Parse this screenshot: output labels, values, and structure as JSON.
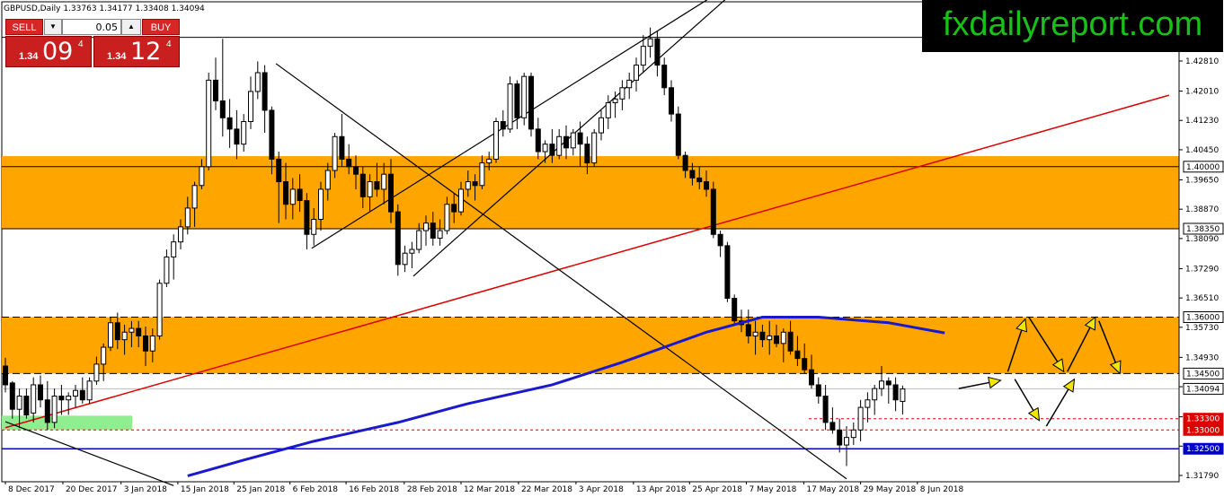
{
  "window": {
    "symbol_info": "GBPUSD,Daily",
    "ohlc": "1.33763 1.34177 1.33408 1.34094"
  },
  "brand": {
    "text": "fxdailyreport.com",
    "color": "#18c018"
  },
  "trade_panel": {
    "sell_label": "SELL",
    "buy_label": "BUY",
    "lot_size": "0.05",
    "sell_quote": {
      "prefix": "1.34",
      "big": "09",
      "sup": "4"
    },
    "buy_quote": {
      "prefix": "1.34",
      "big": "12",
      "sup": "4"
    }
  },
  "colors": {
    "zone": "#ffa500",
    "trendline_red": "#dd0000",
    "moving_average": "#1a1acc",
    "support_blue": "#0000cc",
    "green_zone": "#90ee90",
    "arrow_fill": "#f2e600"
  },
  "chart_data": {
    "type": "candlestick",
    "price_ticks": [
      "1.42810",
      "1.42010",
      "1.41230",
      "1.40450",
      "1.39650",
      "1.38870",
      "1.38090",
      "1.37290",
      "1.36510",
      "1.35730",
      "1.34930",
      "1.34150",
      "1.33350",
      "1.32570",
      "1.31790"
    ],
    "date_labels": [
      "8 Dec 2017",
      "20 Dec 2017",
      "3 Jan 2018",
      "15 Jan 2018",
      "25 Jan 2018",
      "6 Feb 2018",
      "16 Feb 2018",
      "28 Feb 2018",
      "12 Mar 2018",
      "22 Mar 2018",
      "3 Apr 2018",
      "13 Apr 2018",
      "25 Apr 2018",
      "7 May 2018",
      "17 May 2018",
      "29 May 2018",
      "8 Jun 2018"
    ],
    "level_labels": [
      {
        "label": "1.40000",
        "value": 1.4,
        "style": "black-solid"
      },
      {
        "label": "1.38350",
        "value": 1.3835,
        "style": "black-solid"
      },
      {
        "label": "1.36000",
        "value": 1.36,
        "style": "black-dashed"
      },
      {
        "label": "1.34500",
        "value": 1.345,
        "style": "black-dashed"
      },
      {
        "label": "1.34094",
        "value": 1.34094,
        "style": "current-price"
      },
      {
        "label": "1.33300",
        "value": 1.333,
        "style": "red-dashed"
      },
      {
        "label": "1.33000",
        "value": 1.33,
        "style": "red-dashed"
      },
      {
        "label": "1.32500",
        "value": 1.325,
        "style": "blue-solid"
      }
    ],
    "zones": [
      {
        "from": 1.3835,
        "to": 1.4028,
        "color": "orange"
      },
      {
        "from": 1.345,
        "to": 1.36,
        "color": "orange"
      }
    ],
    "candles": [
      [
        1.347,
        1.3492,
        1.34,
        1.342
      ],
      [
        1.3425,
        1.343,
        1.333,
        1.3355
      ],
      [
        1.3355,
        1.341,
        1.3305,
        1.339
      ],
      [
        1.339,
        1.341,
        1.333,
        1.334
      ],
      [
        1.3345,
        1.344,
        1.332,
        1.342
      ],
      [
        1.342,
        1.3445,
        1.336,
        1.338
      ],
      [
        1.338,
        1.343,
        1.33,
        1.332
      ],
      [
        1.332,
        1.341,
        1.3305,
        1.339
      ],
      [
        1.339,
        1.342,
        1.334,
        1.338
      ],
      [
        1.338,
        1.34,
        1.334,
        1.339
      ],
      [
        1.339,
        1.342,
        1.336,
        1.3405
      ],
      [
        1.3405,
        1.344,
        1.337,
        1.338
      ],
      [
        1.338,
        1.344,
        1.337,
        1.343
      ],
      [
        1.343,
        1.3495,
        1.342,
        1.3475
      ],
      [
        1.3475,
        1.353,
        1.343,
        1.352
      ],
      [
        1.352,
        1.36,
        1.351,
        1.3585
      ],
      [
        1.3585,
        1.3612,
        1.3515,
        1.354
      ],
      [
        1.354,
        1.358,
        1.35,
        1.356
      ],
      [
        1.356,
        1.359,
        1.352,
        1.357
      ],
      [
        1.357,
        1.359,
        1.352,
        1.355
      ],
      [
        1.355,
        1.3575,
        1.347,
        1.351
      ],
      [
        1.351,
        1.357,
        1.348,
        1.355
      ],
      [
        1.355,
        1.37,
        1.354,
        1.369
      ],
      [
        1.369,
        1.378,
        1.368,
        1.376
      ],
      [
        1.376,
        1.382,
        1.37,
        1.38
      ],
      [
        1.38,
        1.386,
        1.378,
        1.384
      ],
      [
        1.384,
        1.392,
        1.382,
        1.389
      ],
      [
        1.389,
        1.396,
        1.384,
        1.395
      ],
      [
        1.395,
        1.402,
        1.394,
        1.4
      ],
      [
        1.4,
        1.425,
        1.399,
        1.423
      ],
      [
        1.423,
        1.429,
        1.415,
        1.4175
      ],
      [
        1.4175,
        1.434,
        1.408,
        1.413
      ],
      [
        1.413,
        1.418,
        1.405,
        1.41
      ],
      [
        1.41,
        1.415,
        1.402,
        1.406
      ],
      [
        1.406,
        1.414,
        1.404,
        1.412
      ],
      [
        1.412,
        1.424,
        1.41,
        1.42
      ],
      [
        1.42,
        1.428,
        1.418,
        1.425
      ],
      [
        1.425,
        1.427,
        1.409,
        1.415
      ],
      [
        1.415,
        1.416,
        1.398,
        1.402
      ],
      [
        1.402,
        1.404,
        1.385,
        1.396
      ],
      [
        1.396,
        1.401,
        1.386,
        1.39
      ],
      [
        1.39,
        1.397,
        1.386,
        1.394
      ],
      [
        1.394,
        1.398,
        1.388,
        1.391
      ],
      [
        1.391,
        1.393,
        1.378,
        1.382
      ],
      [
        1.382,
        1.389,
        1.379,
        1.386
      ],
      [
        1.386,
        1.396,
        1.383,
        1.394
      ],
      [
        1.394,
        1.401,
        1.391,
        1.399
      ],
      [
        1.399,
        1.409,
        1.397,
        1.408
      ],
      [
        1.408,
        1.414,
        1.4,
        1.402
      ],
      [
        1.402,
        1.406,
        1.398,
        1.4
      ],
      [
        1.4,
        1.403,
        1.394,
        1.398
      ],
      [
        1.398,
        1.4,
        1.389,
        1.392
      ],
      [
        1.392,
        1.398,
        1.388,
        1.396
      ],
      [
        1.396,
        1.401,
        1.392,
        1.394
      ],
      [
        1.394,
        1.401,
        1.39,
        1.398
      ],
      [
        1.398,
        1.402,
        1.385,
        1.388
      ],
      [
        1.388,
        1.39,
        1.371,
        1.374
      ],
      [
        1.374,
        1.379,
        1.372,
        1.377
      ],
      [
        1.377,
        1.38,
        1.373,
        1.378
      ],
      [
        1.378,
        1.385,
        1.377,
        1.383
      ],
      [
        1.383,
        1.387,
        1.379,
        1.385
      ],
      [
        1.385,
        1.388,
        1.379,
        1.381
      ],
      [
        1.381,
        1.386,
        1.379,
        1.383
      ],
      [
        1.383,
        1.392,
        1.382,
        1.39
      ],
      [
        1.39,
        1.393,
        1.385,
        1.388
      ],
      [
        1.388,
        1.396,
        1.387,
        1.394
      ],
      [
        1.394,
        1.399,
        1.392,
        1.396
      ],
      [
        1.396,
        1.398,
        1.391,
        1.395
      ],
      [
        1.395,
        1.403,
        1.394,
        1.401
      ],
      [
        1.401,
        1.404,
        1.399,
        1.402
      ],
      [
        1.402,
        1.413,
        1.401,
        1.412
      ],
      [
        1.412,
        1.415,
        1.408,
        1.41
      ],
      [
        1.41,
        1.424,
        1.409,
        1.422
      ],
      [
        1.422,
        1.423,
        1.41,
        1.413
      ],
      [
        1.413,
        1.425,
        1.411,
        1.424
      ],
      [
        1.424,
        1.425,
        1.408,
        1.41
      ],
      [
        1.41,
        1.413,
        1.402,
        1.404
      ],
      [
        1.404,
        1.407,
        1.401,
        1.406
      ],
      [
        1.406,
        1.41,
        1.401,
        1.403
      ],
      [
        1.403,
        1.41,
        1.402,
        1.408
      ],
      [
        1.408,
        1.411,
        1.402,
        1.405
      ],
      [
        1.405,
        1.41,
        1.403,
        1.409
      ],
      [
        1.409,
        1.412,
        1.4,
        1.406
      ],
      [
        1.406,
        1.408,
        1.398,
        1.401
      ],
      [
        1.401,
        1.41,
        1.4,
        1.409
      ],
      [
        1.409,
        1.415,
        1.407,
        1.413
      ],
      [
        1.413,
        1.419,
        1.41,
        1.417
      ],
      [
        1.417,
        1.42,
        1.413,
        1.418
      ],
      [
        1.418,
        1.423,
        1.415,
        1.421
      ],
      [
        1.421,
        1.425,
        1.418,
        1.423
      ],
      [
        1.423,
        1.429,
        1.42,
        1.427
      ],
      [
        1.427,
        1.435,
        1.425,
        1.432
      ],
      [
        1.432,
        1.437,
        1.429,
        1.434
      ],
      [
        1.434,
        1.436,
        1.424,
        1.427
      ],
      [
        1.427,
        1.429,
        1.419,
        1.421
      ],
      [
        1.421,
        1.423,
        1.412,
        1.414
      ],
      [
        1.414,
        1.416,
        1.402,
        1.403
      ],
      [
        1.403,
        1.404,
        1.397,
        1.399
      ],
      [
        1.399,
        1.401,
        1.395,
        1.397
      ],
      [
        1.397,
        1.4,
        1.394,
        1.396
      ],
      [
        1.396,
        1.399,
        1.392,
        1.394
      ],
      [
        1.394,
        1.396,
        1.381,
        1.382
      ],
      [
        1.382,
        1.383,
        1.376,
        1.379
      ],
      [
        1.379,
        1.38,
        1.364,
        1.365
      ],
      [
        1.365,
        1.366,
        1.358,
        1.359
      ],
      [
        1.359,
        1.362,
        1.356,
        1.358
      ],
      [
        1.358,
        1.362,
        1.353,
        1.355
      ],
      [
        1.355,
        1.359,
        1.35,
        1.356
      ],
      [
        1.356,
        1.358,
        1.352,
        1.354
      ],
      [
        1.354,
        1.359,
        1.35,
        1.355
      ],
      [
        1.355,
        1.358,
        1.352,
        1.353
      ],
      [
        1.353,
        1.357,
        1.348,
        1.356
      ],
      [
        1.356,
        1.359,
        1.35,
        1.351
      ],
      [
        1.351,
        1.355,
        1.347,
        1.349
      ],
      [
        1.349,
        1.353,
        1.345,
        1.346
      ],
      [
        1.346,
        1.35,
        1.341,
        1.342
      ],
      [
        1.342,
        1.344,
        1.337,
        1.339
      ],
      [
        1.339,
        1.342,
        1.33,
        1.332
      ],
      [
        1.332,
        1.336,
        1.329,
        1.33
      ],
      [
        1.33,
        1.333,
        1.324,
        1.326
      ],
      [
        1.326,
        1.331,
        1.3204,
        1.328
      ],
      [
        1.328,
        1.332,
        1.326,
        1.33
      ],
      [
        1.33,
        1.338,
        1.327,
        1.336
      ],
      [
        1.336,
        1.34,
        1.332,
        1.338
      ],
      [
        1.338,
        1.342,
        1.334,
        1.341
      ],
      [
        1.341,
        1.347,
        1.339,
        1.343
      ],
      [
        1.343,
        1.344,
        1.337,
        1.342
      ],
      [
        1.342,
        1.344,
        1.335,
        1.338
      ],
      [
        1.3376,
        1.3418,
        1.3341,
        1.3409
      ]
    ]
  }
}
